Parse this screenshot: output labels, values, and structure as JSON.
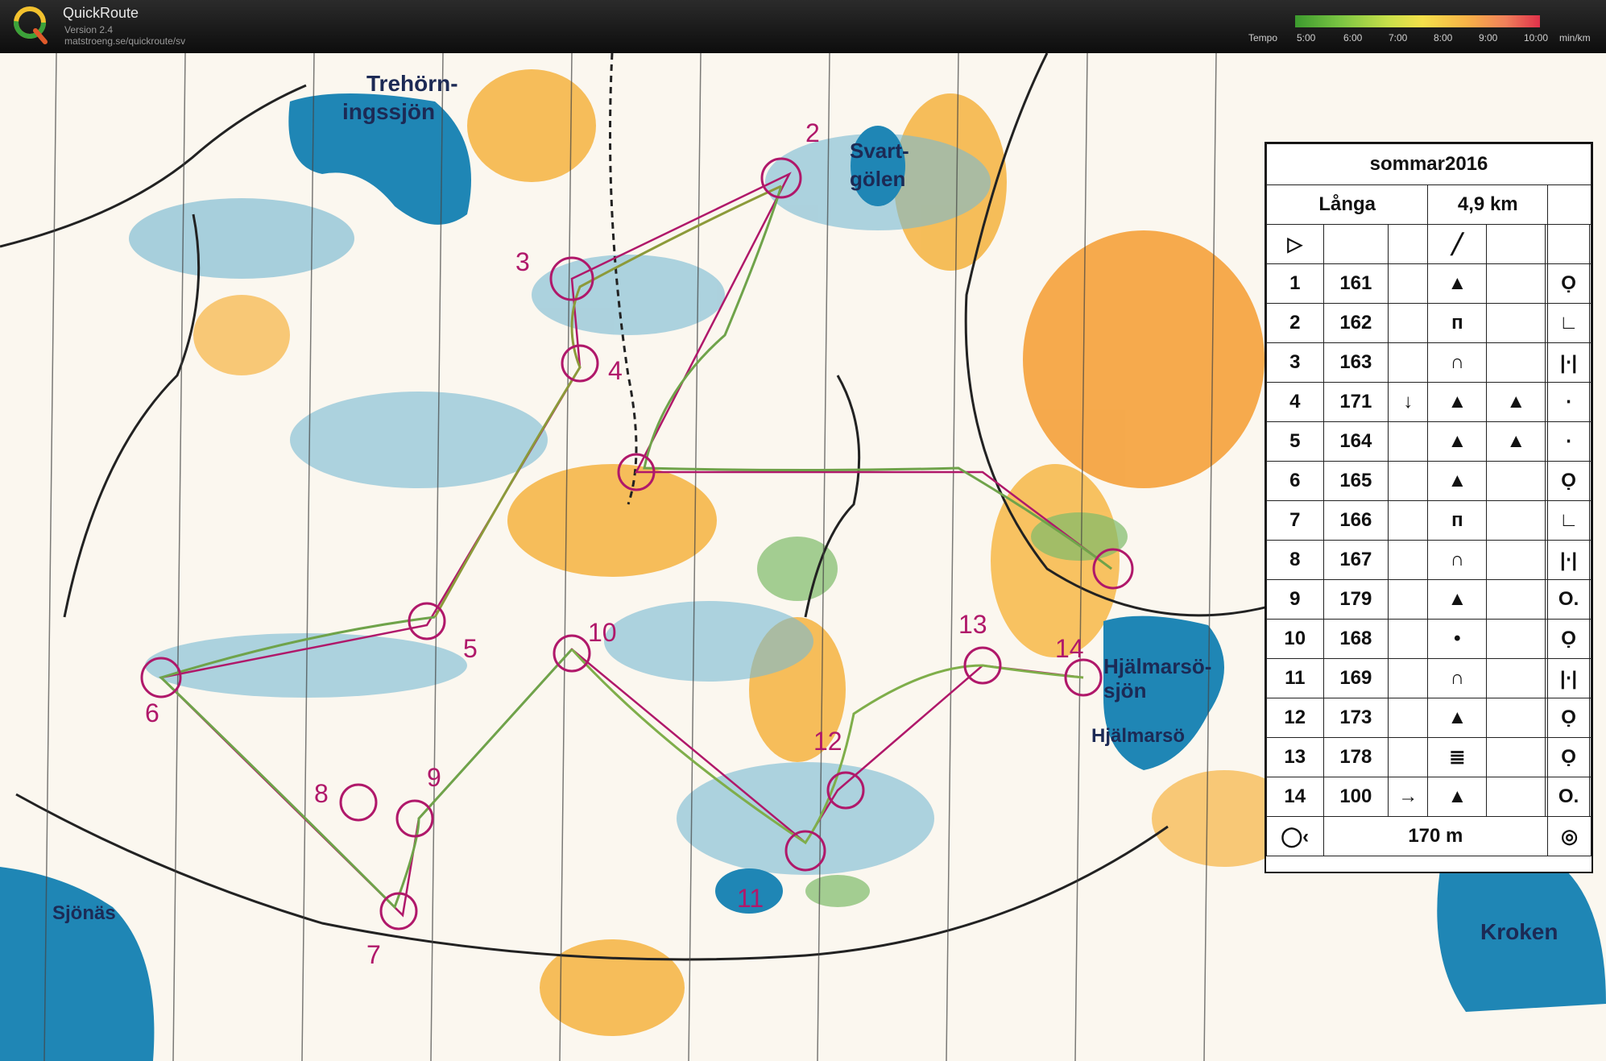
{
  "app": {
    "title": "QuickRoute",
    "version": "Version 2.4",
    "url": "matstroeng.se/quickroute/sv"
  },
  "tempo": {
    "label": "Tempo",
    "ticks": [
      "5:00",
      "6:00",
      "7:00",
      "8:00",
      "9:00",
      "10:00"
    ],
    "unit": "min/km",
    "colors": [
      "#3c9a2e",
      "#79c442",
      "#c8e04a",
      "#f4e04a",
      "#f7b347",
      "#f0805a",
      "#e0314a"
    ]
  },
  "map": {
    "labels": {
      "lake1": "Trehörn-",
      "lake1b": "ingssjön",
      "lake2": "Svart-",
      "lake2b": "gölen",
      "lake3": "Hjälmarsö-",
      "lake3b": "sjön",
      "place1": "Hjälmarsö",
      "place2": "Sjönäs",
      "place3": "Kroken"
    },
    "controls": [
      "2",
      "3",
      "4",
      "5",
      "6",
      "7",
      "8",
      "9",
      "10",
      "11",
      "12",
      "13",
      "14"
    ]
  },
  "description": {
    "event": "sommar2016",
    "course": "Långa",
    "length": "4,9 km",
    "rows": [
      {
        "n": "1",
        "code": "161",
        "c": "",
        "d": "▲",
        "e": "",
        "g": "Ọ"
      },
      {
        "n": "2",
        "code": "162",
        "c": "",
        "d": "ᴨ",
        "e": "",
        "g": "∟"
      },
      {
        "n": "3",
        "code": "163",
        "c": "",
        "d": "∩",
        "e": "",
        "g": "|⋅|"
      },
      {
        "n": "4",
        "code": "171",
        "c": "↓",
        "d": "▲",
        "e": "▲",
        "g": "⋅"
      },
      {
        "n": "5",
        "code": "164",
        "c": "",
        "d": "▲",
        "e": "▲",
        "g": "⋅"
      },
      {
        "n": "6",
        "code": "165",
        "c": "",
        "d": "▲",
        "e": "",
        "g": "Ọ"
      },
      {
        "n": "7",
        "code": "166",
        "c": "",
        "d": "ᴨ",
        "e": "",
        "g": "∟"
      },
      {
        "n": "8",
        "code": "167",
        "c": "",
        "d": "∩",
        "e": "",
        "g": "|⋅|"
      },
      {
        "n": "9",
        "code": "179",
        "c": "",
        "d": "▲",
        "e": "",
        "g": "O."
      },
      {
        "n": "10",
        "code": "168",
        "c": "",
        "d": "•",
        "e": "",
        "g": "Ọ"
      },
      {
        "n": "11",
        "code": "169",
        "c": "",
        "d": "∩",
        "e": "",
        "g": "|⋅|"
      },
      {
        "n": "12",
        "code": "173",
        "c": "",
        "d": "▲",
        "e": "",
        "g": "Ọ"
      },
      {
        "n": "13",
        "code": "178",
        "c": "",
        "d": "≣",
        "e": "",
        "g": "Ọ"
      },
      {
        "n": "14",
        "code": "100",
        "c": "→",
        "d": "▲",
        "e": "",
        "g": "O."
      }
    ],
    "finish": "170 m"
  }
}
